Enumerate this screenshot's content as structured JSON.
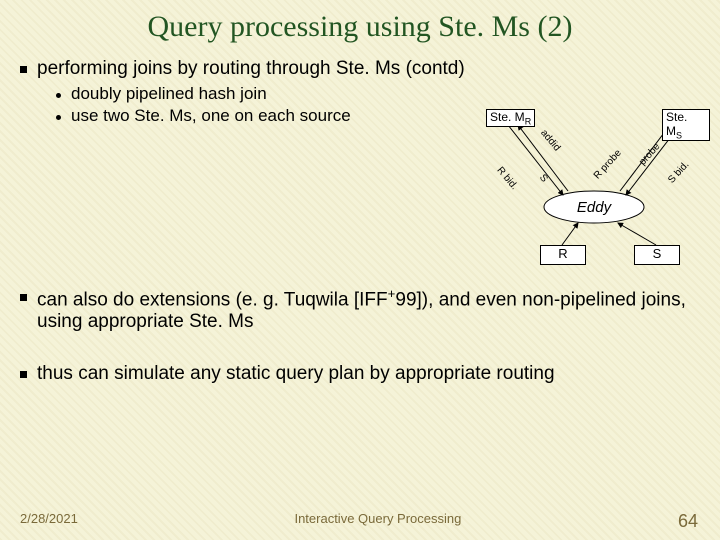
{
  "title": "Query processing using Ste. Ms (2)",
  "bullets": {
    "b1": "performing joins by routing through Ste. Ms (contd)",
    "b1_1": "doubly pipelined hash join",
    "b1_2": "use two Ste. Ms, one on each source",
    "b2_pre": "can also do extensions (e. g. Tuqwila [IFF",
    "b2_sup": "+",
    "b2_post": "99]), and even non-pipelined joins, using appropriate Ste. Ms",
    "b3": "thus can simulate any static query plan by appropriate routing"
  },
  "diagram": {
    "stem": "Ste. M",
    "stemR": "R",
    "stemS": "S",
    "eddy": "Eddy",
    "srcR": "R",
    "srcS": "S",
    "labels": {
      "rbid_left": "R bid.",
      "s_up": "S",
      "addid": "addid",
      "rprobe": "R probe",
      "probe": "probe",
      "sbid": "S bid."
    }
  },
  "footer": {
    "date": "2/28/2021",
    "center": "Interactive Query Processing",
    "page": "64"
  }
}
